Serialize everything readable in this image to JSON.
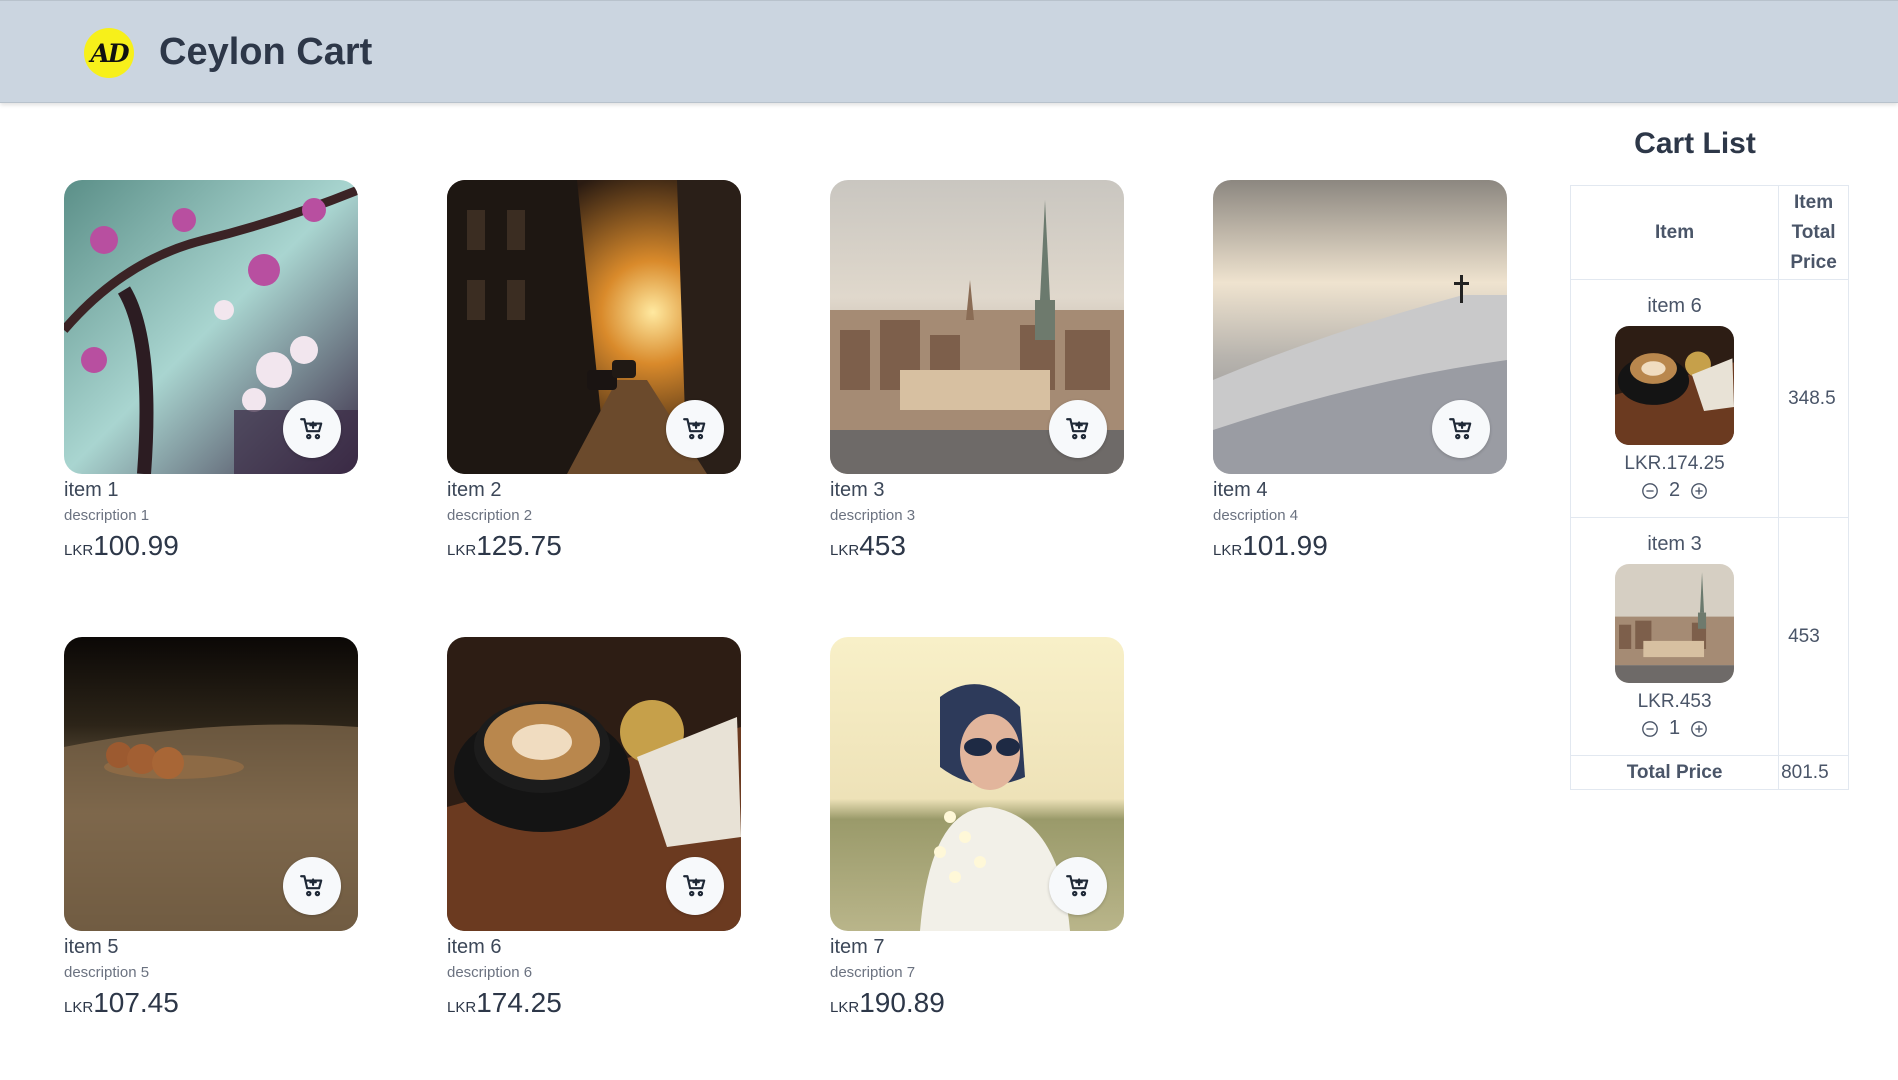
{
  "header": {
    "logo_text": "AD",
    "title": "Ceylon Cart"
  },
  "products": [
    {
      "name": "item 1",
      "description": "description 1",
      "currency": "LKR",
      "price": "100.99",
      "image": "cherry-blossom-photo"
    },
    {
      "name": "item 2",
      "description": "description 2",
      "currency": "LKR",
      "price": "125.75",
      "image": "sunset-street-photo"
    },
    {
      "name": "item 3",
      "description": "description 3",
      "currency": "LKR",
      "price": "453",
      "image": "city-skyline-photo"
    },
    {
      "name": "item 4",
      "description": "description 4",
      "currency": "LKR",
      "price": "101.99",
      "image": "snowy-hill-photo"
    },
    {
      "name": "item 5",
      "description": "description 5",
      "currency": "LKR",
      "price": "107.45",
      "image": "pods-on-wood-photo"
    },
    {
      "name": "item 6",
      "description": "description 6",
      "currency": "LKR",
      "price": "174.25",
      "image": "coffee-cup-photo"
    },
    {
      "name": "item 7",
      "description": "description 7",
      "currency": "LKR",
      "price": "190.89",
      "image": "woman-flowers-photo"
    }
  ],
  "cart": {
    "title": "Cart List",
    "headers": {
      "item": "Item",
      "total": "Item Total Price"
    },
    "items": [
      {
        "name": "item 6",
        "price": "LKR.174.25",
        "quantity": "2",
        "total": "348.5",
        "image": "coffee-cup-photo"
      },
      {
        "name": "item 3",
        "price": "LKR.453",
        "quantity": "1",
        "total": "453",
        "image": "city-skyline-photo"
      }
    ],
    "total_label": "Total Price",
    "total_value": "801.5"
  },
  "colors": {
    "header_bg": "#cbd5e0",
    "logo_bg": "#f7f01a",
    "text": "#2d3748"
  }
}
